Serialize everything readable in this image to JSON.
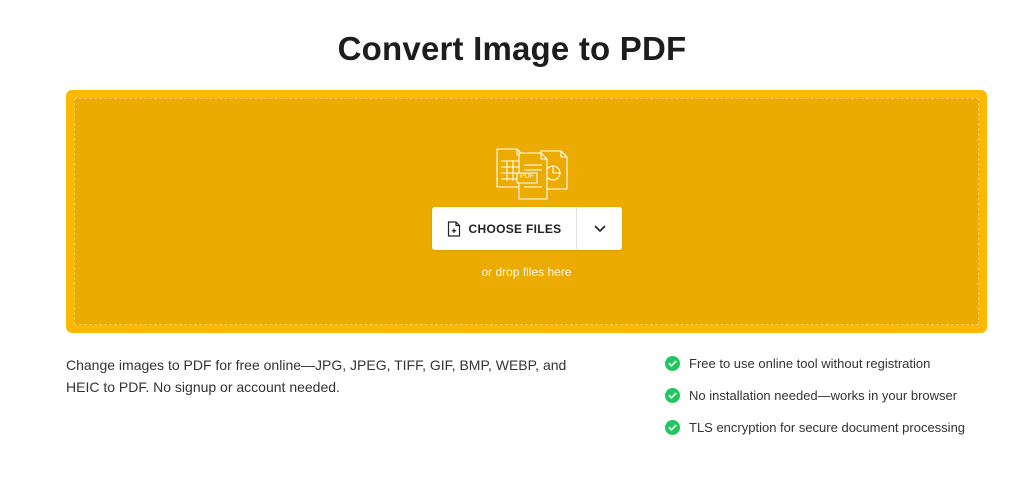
{
  "page": {
    "title": "Convert Image to PDF"
  },
  "dropzone": {
    "choose_label": "CHOOSE FILES",
    "drop_hint": "or drop files here",
    "illustration_badge": "PDF",
    "icons": {
      "illustration": "files-to-pdf-icon",
      "choose": "file-add-icon",
      "dropdown": "chevron-down-icon"
    }
  },
  "description": {
    "text": "Change images to PDF for free online—JPG, JPEG, TIFF, GIF, BMP, WEBP, and HEIC to PDF. No signup or account needed."
  },
  "features": [
    {
      "text": "Free to use online tool without registration",
      "icon": "check-circle-icon"
    },
    {
      "text": "No installation needed—works in your browser",
      "icon": "check-circle-icon"
    },
    {
      "text": "TLS encryption for secure document processing",
      "icon": "check-circle-icon"
    }
  ],
  "colors": {
    "dropzone_border": "#fdb900",
    "dropzone_fill": "#ecab00",
    "check": "#22c55e"
  }
}
